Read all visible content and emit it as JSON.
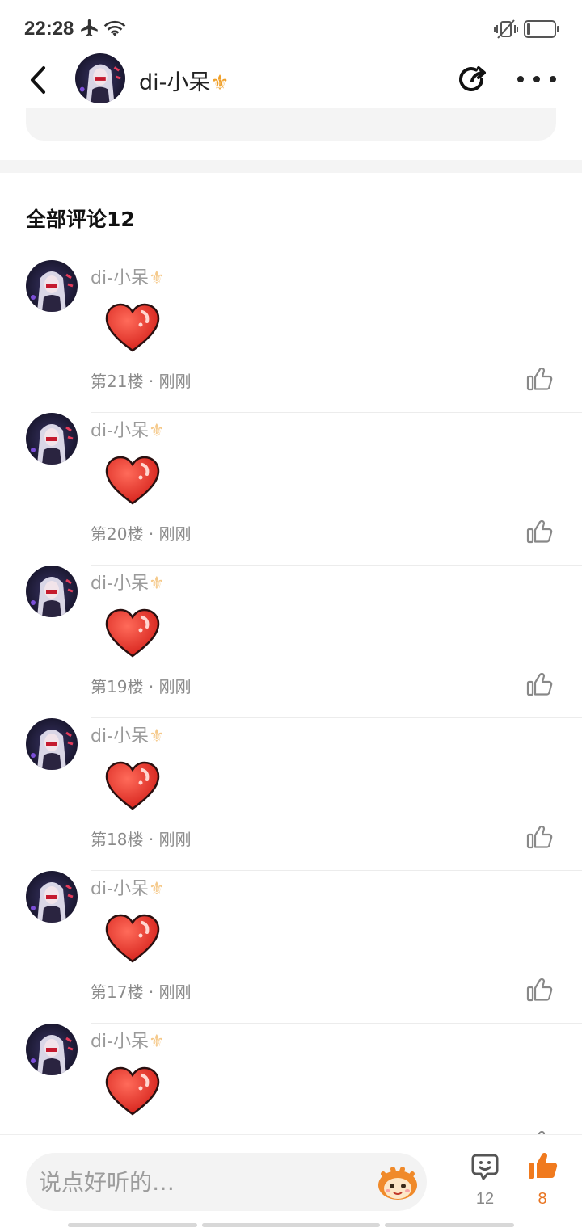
{
  "status_bar": {
    "time": "22:28",
    "icons": [
      "airplane-icon",
      "wifi-icon",
      "vibrate-mute-icon",
      "battery-icon"
    ]
  },
  "header": {
    "username": "di-小呆",
    "badge": "⚜",
    "icons": [
      "back-arrow-icon",
      "share-icon",
      "more-icon"
    ]
  },
  "comments_section": {
    "heading": "全部评论12"
  },
  "comments": [
    {
      "author": "di-小呆",
      "badge": "⚜",
      "content": "heart-emoji",
      "floor": "第21楼",
      "time": "刚刚",
      "separator": "·"
    },
    {
      "author": "di-小呆",
      "badge": "⚜",
      "content": "heart-emoji",
      "floor": "第20楼",
      "time": "刚刚",
      "separator": "·"
    },
    {
      "author": "di-小呆",
      "badge": "⚜",
      "content": "heart-emoji",
      "floor": "第19楼",
      "time": "刚刚",
      "separator": "·"
    },
    {
      "author": "di-小呆",
      "badge": "⚜",
      "content": "heart-emoji",
      "floor": "第18楼",
      "time": "刚刚",
      "separator": "·"
    },
    {
      "author": "di-小呆",
      "badge": "⚜",
      "content": "heart-emoji",
      "floor": "第17楼",
      "time": "刚刚",
      "separator": "·"
    },
    {
      "author": "di-小呆",
      "badge": "⚜",
      "content": "heart-emoji",
      "floor": "",
      "time": "",
      "separator": ""
    }
  ],
  "bottom_bar": {
    "input_placeholder": "说点好听的…",
    "comment_count": "12",
    "like_count": "8"
  },
  "colors": {
    "accent": "#e8731f",
    "badge_gold": "#f0a02a",
    "heart_red": "#e8342a",
    "muted_text": "#9a9a9a"
  }
}
